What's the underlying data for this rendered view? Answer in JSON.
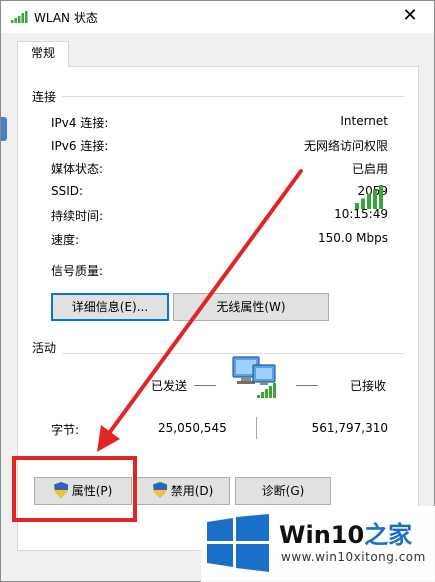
{
  "window": {
    "title": "WLAN 状态",
    "close_glyph": "✕"
  },
  "tabs": [
    {
      "label": "常规"
    }
  ],
  "connection": {
    "section_label": "连接",
    "rows": [
      {
        "label": "IPv4 连接:",
        "value": "Internet"
      },
      {
        "label": "IPv6 连接:",
        "value": "无网络访问权限"
      },
      {
        "label": "媒体状态:",
        "value": "已启用"
      },
      {
        "label": "SSID:",
        "value": "2059"
      },
      {
        "label": "持续时间:",
        "value": "10:15:49"
      },
      {
        "label": "速度:",
        "value": "150.0 Mbps"
      }
    ],
    "signal_label": "信号质量:",
    "signal_bars": 5,
    "signal_bars_filled": 5,
    "details_button": "详细信息(E)...",
    "wireless_props_button": "无线属性(W)"
  },
  "activity": {
    "section_label": "活动",
    "sent_label": "已发送",
    "received_label": "已接收",
    "bytes_label": "字节:",
    "bytes_sent": "25,050,545",
    "bytes_received": "561,797,310"
  },
  "buttons": {
    "properties": "属性(P)",
    "disable": "禁用(D)",
    "diagnose": "诊断(G)"
  },
  "watermark": {
    "title_prefix": "Win10",
    "title_suffix": "之家",
    "url": "www.win10xitong.com"
  },
  "colors": {
    "accent": "#0078d7",
    "annotation_red": "#e02525",
    "signal_green": "#3aa53a",
    "brand_blue": "#1a6fc9"
  }
}
